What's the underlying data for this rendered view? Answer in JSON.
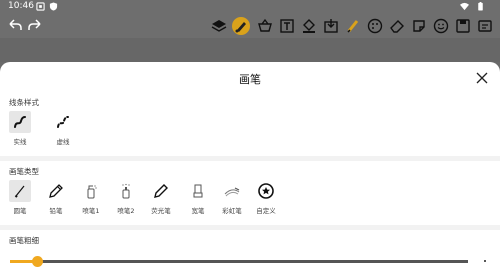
{
  "status": {
    "time": "10:46"
  },
  "sheet": {
    "title": "画笔",
    "close_icon": "close-icon"
  },
  "line_style": {
    "label": "线条样式",
    "options": [
      {
        "label": "实线",
        "icon": "solid-line-icon",
        "selected": true
      },
      {
        "label": "虚线",
        "icon": "dashed-line-icon",
        "selected": false
      }
    ]
  },
  "brush_type": {
    "label": "画笔类型",
    "options": [
      {
        "label": "圆笔",
        "icon": "round-brush-icon",
        "selected": true
      },
      {
        "label": "铅笔",
        "icon": "pencil-icon",
        "selected": false
      },
      {
        "label": "喷笔1",
        "icon": "spray-brush-1-icon",
        "selected": false
      },
      {
        "label": "喷笔2",
        "icon": "spray-brush-2-icon",
        "selected": false
      },
      {
        "label": "荧光笔",
        "icon": "highlighter-icon",
        "selected": false
      },
      {
        "label": "宽笔",
        "icon": "wide-brush-icon",
        "selected": false
      },
      {
        "label": "彩虹笔",
        "icon": "rainbow-brush-icon",
        "selected": false
      },
      {
        "label": "自定义",
        "icon": "custom-brush-icon",
        "selected": false
      }
    ]
  },
  "brush_size": {
    "label": "画笔粗细",
    "value_fraction": 0.03
  },
  "colors": {
    "accent": "#f0a81f",
    "active_tool": "#d9a21b"
  }
}
